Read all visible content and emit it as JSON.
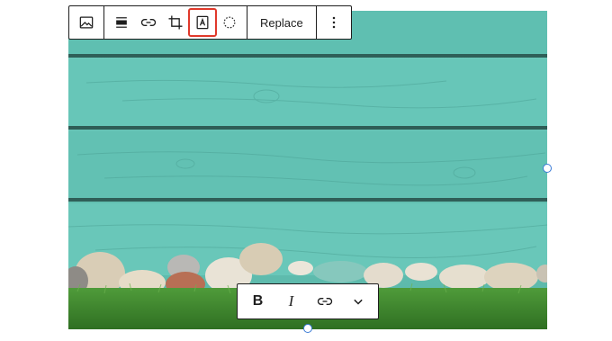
{
  "block_toolbar": {
    "icons": {
      "image": "image-icon",
      "align": "align-icon",
      "link": "link-icon",
      "crop": "crop-icon",
      "text_overlay": "text-overlay-icon",
      "duotone": "duotone-icon",
      "more": "more-vertical-icon"
    },
    "replace_label": "Replace",
    "selected_tool": "text_overlay",
    "highlight_color": "#e0392b"
  },
  "format_toolbar": {
    "bold_label": "B",
    "italic_label": "I",
    "icons": {
      "link": "link-icon",
      "more": "chevron-down-icon"
    }
  },
  "image": {
    "subject": "wood-planks-and-stones",
    "colors": {
      "wood": "#63c2b5",
      "grass": "#3f8a2e"
    }
  },
  "accent_color": "#3b7bd6"
}
